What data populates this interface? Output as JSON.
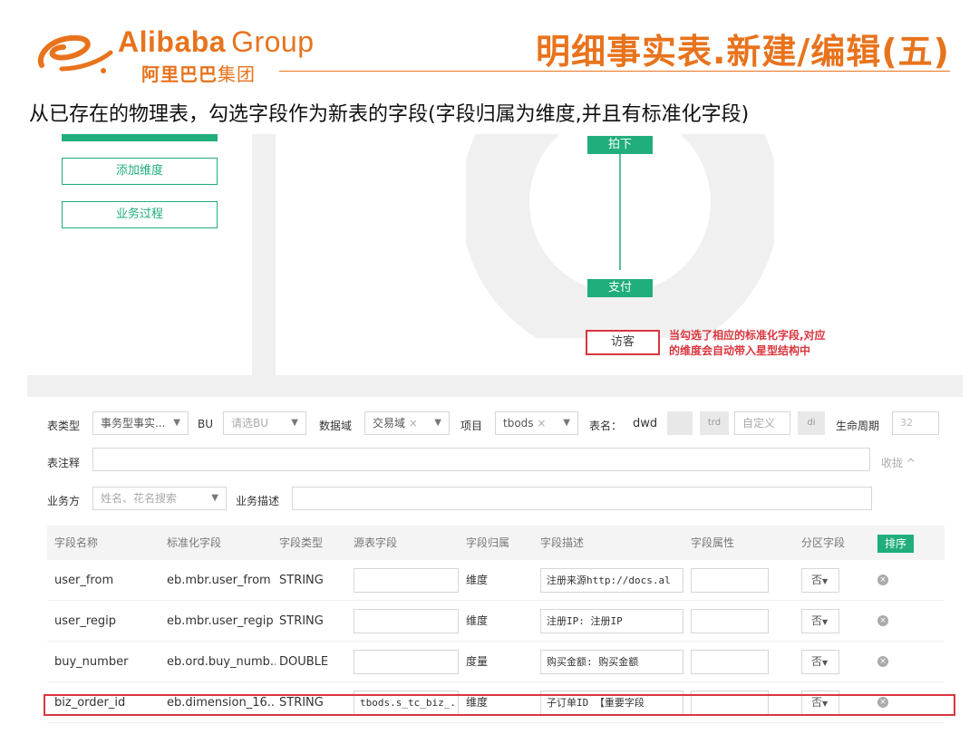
{
  "header": {
    "brand_en": "Alibaba",
    "brand_group": "Group",
    "brand_cn_bold": "阿里巴巴",
    "brand_cn_light": "集团",
    "title": "明细事实表.新建/编辑(五)"
  },
  "subtitle": "从已存在的物理表，勾选字段作为新表的字段(字段归属为维度,并且有标准化字段)",
  "left_panel": {
    "buttons": [
      "添加维度",
      "业务过程"
    ]
  },
  "diagram": {
    "top_node": "拍下",
    "bottom_node": "支付",
    "visitor_node": "访客",
    "annotation_line1": "当勾选了相应的标准化字段,对应",
    "annotation_line2": "的维度会自动带入星型结构中"
  },
  "form": {
    "table_type_label": "表类型",
    "table_type_value": "事务型事实...",
    "bu_label": "BU",
    "bu_placeholder": "请选BU",
    "data_domain_label": "数据域",
    "data_domain_value": "交易域",
    "project_label": "项目",
    "project_value": "tbods",
    "table_name_label": "表名：",
    "table_name_prefix": "dwd",
    "table_name_trd": "trd",
    "table_name_custom": "自定义",
    "table_name_suffix": "di",
    "lifecycle_label": "生命周期",
    "lifecycle_value": "32",
    "comment_label": "表注释",
    "collapse_label": "收拢 ^",
    "owner_label": "业务方",
    "owner_placeholder": "姓名、花名搜索",
    "biz_desc_label": "业务描述"
  },
  "table": {
    "columns": [
      "字段名称",
      "标准化字段",
      "字段类型",
      "源表字段",
      "字段归属",
      "字段描述",
      "字段属性",
      "分区字段"
    ],
    "sort_label": "排序",
    "rows": [
      {
        "name": "user_from",
        "std": "eb.mbr.user_from",
        "type": "STRING",
        "src": "",
        "belong": "维度",
        "desc": "注册来源http://docs.al",
        "partition": "否"
      },
      {
        "name": "user_regip",
        "std": "eb.mbr.user_regip",
        "type": "STRING",
        "src": "",
        "belong": "维度",
        "desc": "注册IP: 注册IP",
        "partition": "否"
      },
      {
        "name": "buy_number",
        "std": "eb.ord.buy_numb..",
        "type": "DOUBLE",
        "src": "",
        "belong": "度量",
        "desc": "购买金额: 购买金额",
        "partition": "否"
      },
      {
        "name": "biz_order_id",
        "std": "eb.dimension_16...",
        "type": "STRING",
        "src": "tbods.s_tc_biz_...",
        "belong": "维度",
        "desc": "子订单ID    【重要字段",
        "partition": "否"
      }
    ]
  },
  "colors": {
    "brand_orange": "#e8731d",
    "accent_green": "#1fae7c",
    "highlight_red": "#d9363e"
  }
}
